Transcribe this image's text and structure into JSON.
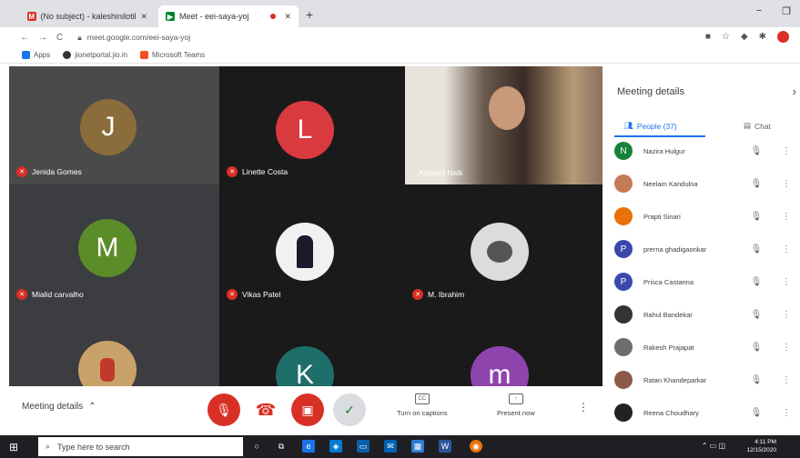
{
  "browser": {
    "tabs": [
      {
        "label": "(No subject) - kaleshinilotikar@g",
        "favicon": "gmail-icon",
        "color": "#d93025",
        "active": false
      },
      {
        "label": "Meet - eei-saya-yoj",
        "favicon": "meet-icon",
        "color": "#00832d",
        "active": true
      }
    ],
    "url": "meet.google.com/eei-saya-yoj",
    "bookmarks": [
      "Apps",
      "jionetportal.jio.in",
      "Microsoft Teams"
    ]
  },
  "participants": [
    {
      "name": "Jenida Gomes",
      "initial": "J",
      "avatar_color": "#8a6d3b",
      "muted": true
    },
    {
      "name": "Linette Costa",
      "initial": "L",
      "avatar_color": "#d93a3f",
      "muted": true
    },
    {
      "name": "Ashwini Naik",
      "initial": "",
      "avatar_color": "#4a3a35",
      "muted": false
    },
    {
      "name": "Mialid carvalho",
      "initial": "M",
      "avatar_color": "#5b8c2a",
      "muted": true
    },
    {
      "name": "Vikas Patel",
      "initial": "",
      "avatar_color": "#f1f1f1",
      "muted": true
    },
    {
      "name": "M. Ibrahim",
      "initial": "",
      "avatar_color": "#dcdcdc",
      "muted": true
    },
    {
      "name": "",
      "initial": "",
      "avatar_color": "#c9a26a",
      "muted": false
    },
    {
      "name": "",
      "initial": "K",
      "avatar_color": "#1e6e6a",
      "muted": false
    },
    {
      "name": "",
      "initial": "m",
      "avatar_color": "#8e44ad",
      "muted": false
    }
  ],
  "panel": {
    "title": "Meeting details",
    "people_tab": "People (37)",
    "chat_tab": "Chat",
    "people": [
      {
        "name": "Nazira Hulgur",
        "initial": "N",
        "color": "#188038"
      },
      {
        "name": "Neelam Kandulna",
        "initial": "",
        "color": "#c57b57"
      },
      {
        "name": "Prapti Sinari",
        "initial": "",
        "color": "#e8710a"
      },
      {
        "name": "prerna ghadigaonkar",
        "initial": "P",
        "color": "#3949ab"
      },
      {
        "name": "Prisca Castanna",
        "initial": "P",
        "color": "#3949ab"
      },
      {
        "name": "Rahul Bandekar",
        "initial": "",
        "color": "#333333"
      },
      {
        "name": "Rakesh Prajapat",
        "initial": "",
        "color": "#6d6d6d"
      },
      {
        "name": "Ratan Khandeparkar",
        "initial": "",
        "color": "#8d5a4a"
      },
      {
        "name": "Reena Choudhary",
        "initial": "",
        "color": "#222222"
      }
    ]
  },
  "controls": {
    "meeting_details": "Meeting details",
    "captions": "Turn on captions",
    "present": "Present now"
  },
  "taskbar": {
    "search_placeholder": "Type here to search",
    "time": "4:11 PM",
    "date": "12/15/2020"
  }
}
